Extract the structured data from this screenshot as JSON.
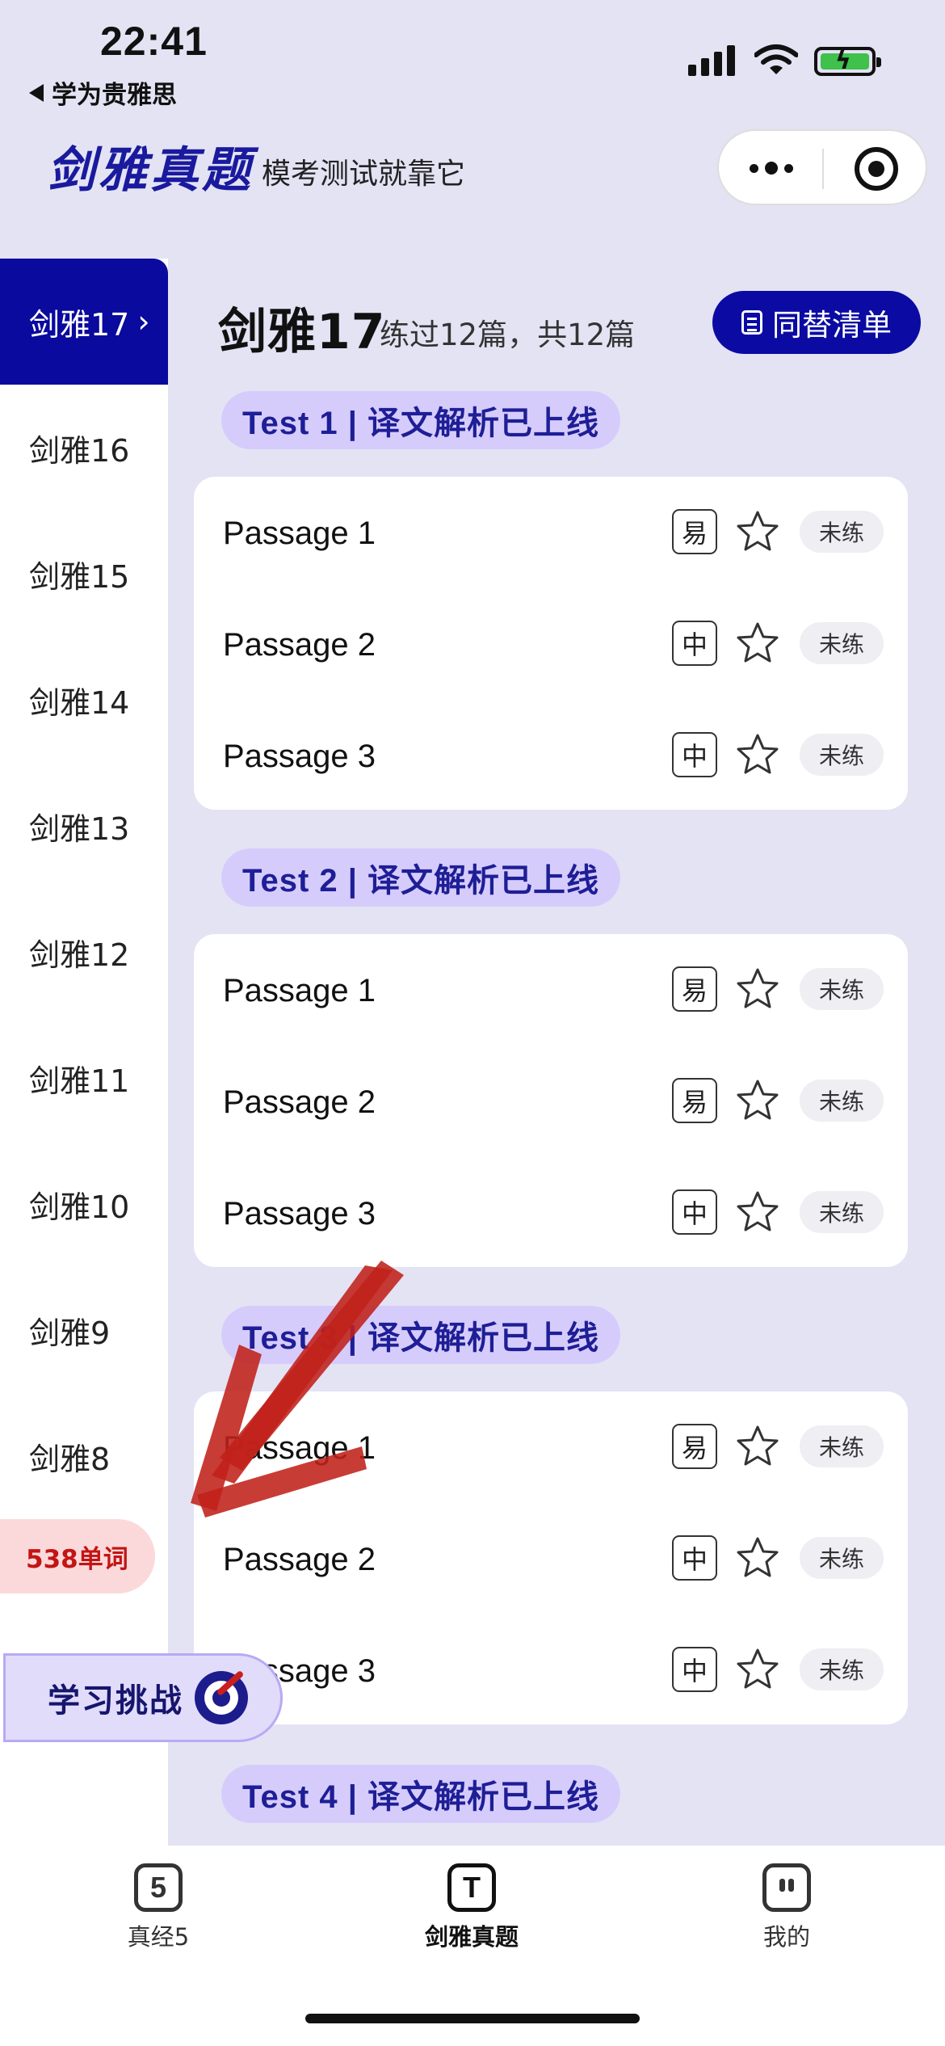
{
  "status_bar": {
    "time": "22:41",
    "back_label": "学为贵雅思"
  },
  "header": {
    "title": "剑雅真题",
    "subtitle": "模考测试就靠它"
  },
  "sidebar": {
    "items": [
      {
        "label": "剑雅17",
        "active": true
      },
      {
        "label": "剑雅16"
      },
      {
        "label": "剑雅15"
      },
      {
        "label": "剑雅14"
      },
      {
        "label": "剑雅13"
      },
      {
        "label": "剑雅12"
      },
      {
        "label": "剑雅11"
      },
      {
        "label": "剑雅10"
      },
      {
        "label": "剑雅9"
      },
      {
        "label": "剑雅8"
      }
    ],
    "word_badge": "538单词",
    "challenge_label": "学习挑战"
  },
  "main": {
    "title": "剑雅17",
    "progress": "练过12篇，共12篇",
    "synonym_button": "同替清单",
    "tests": [
      {
        "tag": "Test 1 | 译文解析已上线",
        "passages": [
          {
            "name": "Passage 1",
            "difficulty": "易",
            "status": "未练"
          },
          {
            "name": "Passage 2",
            "difficulty": "中",
            "status": "未练"
          },
          {
            "name": "Passage 3",
            "difficulty": "中",
            "status": "未练"
          }
        ]
      },
      {
        "tag": "Test 2 | 译文解析已上线",
        "passages": [
          {
            "name": "Passage 1",
            "difficulty": "易",
            "status": "未练"
          },
          {
            "name": "Passage 2",
            "difficulty": "易",
            "status": "未练"
          },
          {
            "name": "Passage 3",
            "difficulty": "中",
            "status": "未练"
          }
        ]
      },
      {
        "tag": "Test 3 | 译文解析已上线",
        "passages": [
          {
            "name": "Passage 1",
            "difficulty": "易",
            "status": "未练"
          },
          {
            "name": "Passage 2",
            "difficulty": "中",
            "status": "未练"
          },
          {
            "name": "Passage 3",
            "difficulty": "中",
            "status": "未练"
          }
        ]
      },
      {
        "tag": "Test 4 | 译文解析已上线",
        "passages": []
      }
    ]
  },
  "tabbar": {
    "tabs": [
      {
        "icon_text": "5",
        "label": "真经5",
        "icon": "number-five-icon"
      },
      {
        "icon_text": "T",
        "label": "剑雅真题",
        "icon": "letter-t-icon",
        "active": true
      },
      {
        "icon_text": "",
        "label": "我的",
        "icon": "profile-face-icon"
      }
    ]
  },
  "colors": {
    "accent": "#0a0a9e",
    "tag_bg": "#d6ccfc",
    "background": "#e4e3f4",
    "annotation": "#c0211a"
  }
}
